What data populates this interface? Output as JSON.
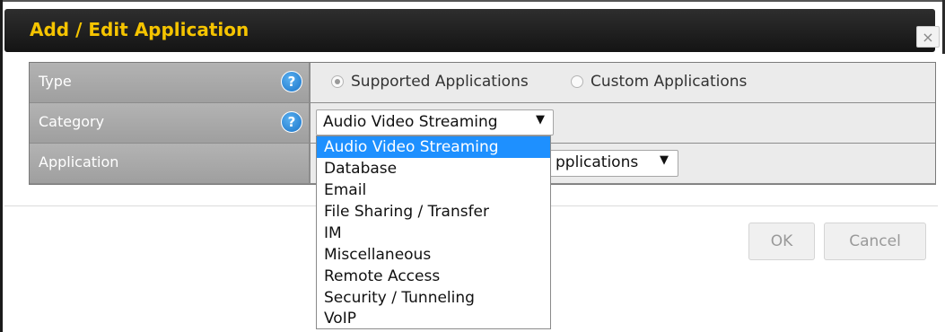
{
  "dialog": {
    "title": "Add / Edit Application",
    "close_glyph": "×"
  },
  "form": {
    "type": {
      "label": "Type",
      "help_glyph": "?",
      "options": [
        {
          "label": "Supported Applications",
          "selected": true
        },
        {
          "label": "Custom Applications",
          "selected": false
        }
      ]
    },
    "category": {
      "label": "Category",
      "help_glyph": "?",
      "selected": "Audio Video Streaming",
      "arrow": "▼"
    },
    "application": {
      "label": "Application",
      "selected_partial": "pplications",
      "arrow": "▼"
    }
  },
  "category_dropdown": {
    "options": [
      "Audio Video Streaming",
      "Database",
      "Email",
      "File Sharing / Transfer",
      "IM",
      "Miscellaneous",
      "Remote Access",
      "Security / Tunneling",
      "VoIP"
    ],
    "highlighted_index": 0
  },
  "buttons": {
    "ok": "OK",
    "cancel": "Cancel"
  },
  "colors": {
    "title": "#f5c400",
    "titlebar": "#1f1f1f",
    "label_cell": "#a8a8a8",
    "value_cell": "#ebebeb",
    "highlight": "#1e90ff",
    "help_icon": "#1a74c9"
  },
  "icons": {
    "help": "help-icon",
    "close": "close-icon",
    "dropdown": "chevron-down-icon"
  }
}
